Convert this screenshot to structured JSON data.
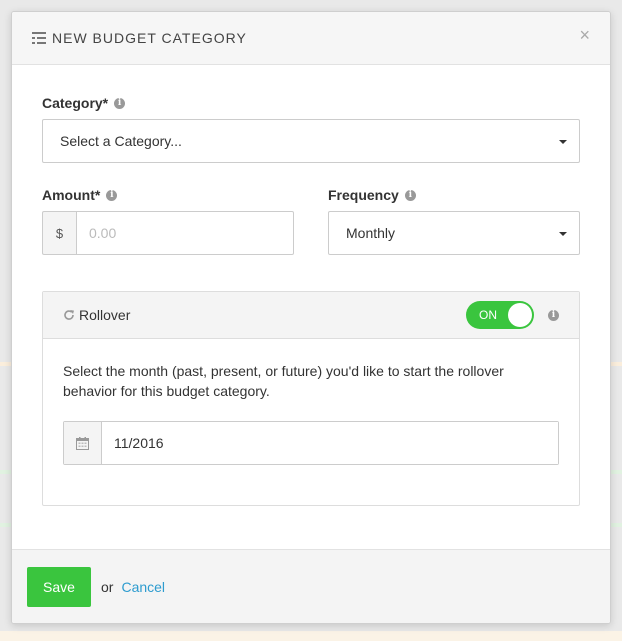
{
  "modal": {
    "title": "NEW BUDGET CATEGORY",
    "close_label": "×"
  },
  "category": {
    "label": "Category*",
    "selected": "Select a Category..."
  },
  "amount": {
    "label": "Amount*",
    "currency": "$",
    "placeholder": "0.00",
    "value": ""
  },
  "frequency": {
    "label": "Frequency",
    "selected": "Monthly"
  },
  "rollover": {
    "title": "Rollover",
    "toggle_label": "ON",
    "enabled": true,
    "description": "Select the month (past, present, or future) you'd like to start the rollover behavior for this budget category.",
    "start_month": "11/2016"
  },
  "footer": {
    "save_label": "Save",
    "or_text": "or",
    "cancel_label": "Cancel"
  },
  "icons": {
    "header": "list-icon",
    "info": "info-icon",
    "refresh": "refresh-icon",
    "calendar": "calendar-icon",
    "caret": "caret-down-icon"
  },
  "colors": {
    "accent_green": "#3ac53e",
    "link_blue": "#2e9ccf"
  }
}
